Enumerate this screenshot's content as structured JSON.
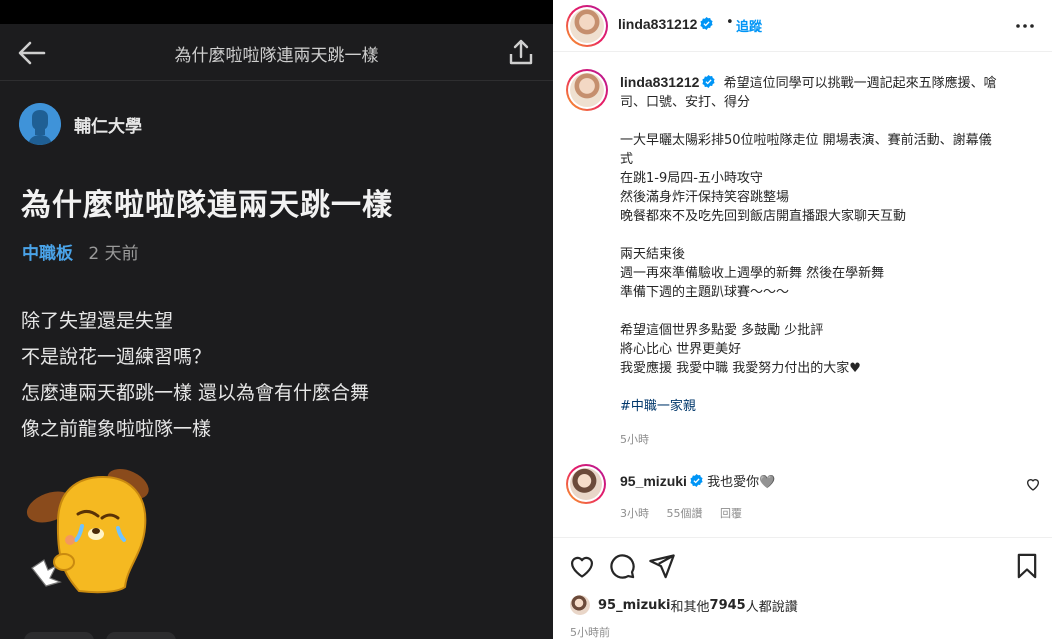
{
  "forum": {
    "topbar_title": "為什麼啦啦隊連兩天跳一樣",
    "author_name": "輔仁大學",
    "post_title": "為什麼啦啦隊連兩天跳一樣",
    "board": "中職板",
    "time": "2 天前",
    "body": [
      "除了失望還是失望",
      "不是說花一週練習嗎？",
      "怎麼連兩天都跳一樣 還以為會有什麼合舞",
      "像之前龍象啦啦隊一樣"
    ],
    "accent_color": "#4aa3e8",
    "background_color": "#1c1c1e"
  },
  "instagram": {
    "header": {
      "username": "linda831212",
      "separator": "•",
      "follow_label": "追蹤"
    },
    "caption": {
      "username": "linda831212",
      "first_line_text": "希望這位同學可以挑戰一週記起來五隊應援、嗆",
      "lines": [
        "司、口號、安打、得分",
        "",
        "一大早曬太陽彩排50位啦啦隊走位 開場表演、賽前活動、謝幕儀",
        "式",
        "在跳1-9局四-五小時攻守",
        "然後滿身炸汗保持笑容跳整場",
        "晚餐都來不及吃先回到飯店開直播跟大家聊天互動",
        "",
        "兩天結束後",
        "週一再來準備驗收上週學的新舞 然後在學新舞",
        "準備下週的主題趴球賽～～～",
        "",
        "希望這個世界多點愛 多鼓勵 少批評",
        "將心比心 世界更美好",
        "我愛應援 我愛中職 我愛努力付出的大家♥",
        ""
      ],
      "hashtag": "#中職一家親",
      "time": "5小時"
    },
    "comment": {
      "username": "95_mizuki",
      "text": "我也愛你🩶",
      "time": "3小時",
      "likes": "55個讚",
      "reply_label": "回覆"
    },
    "likes": {
      "user": "95_mizuki",
      "text_mid": "和其他",
      "count": "7945",
      "text_end": " 人都說讚"
    },
    "post_age": "5小時前",
    "link_color": "#0095f6"
  }
}
